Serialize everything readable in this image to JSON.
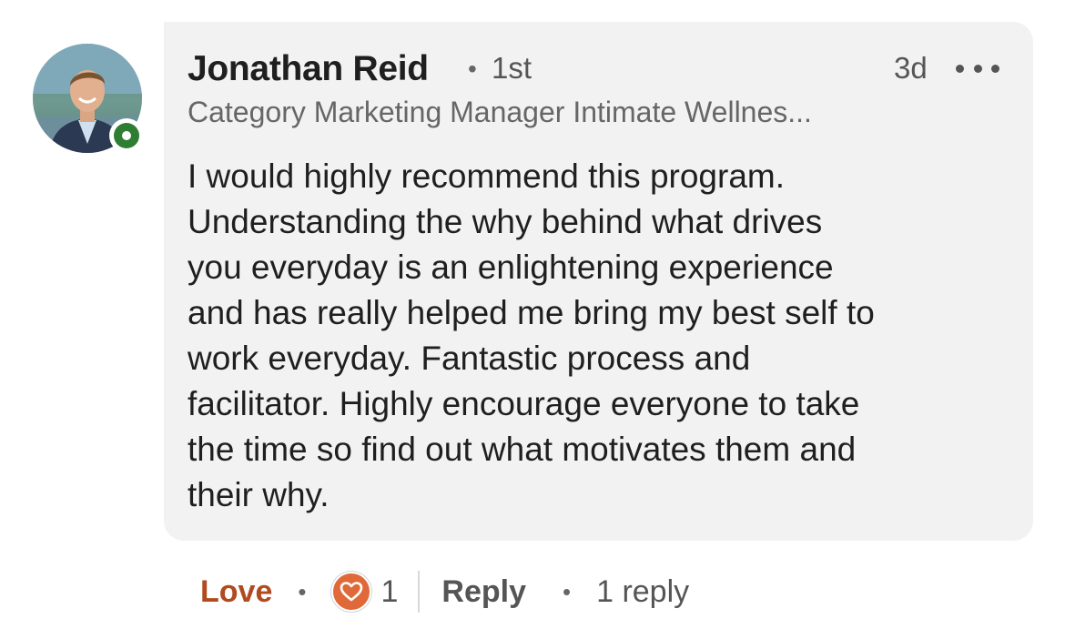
{
  "comment": {
    "author": {
      "name": "Jonathan Reid",
      "connection_degree": "1st",
      "headline": "Category Marketing Manager Intimate Wellnes...",
      "online_status": "online"
    },
    "time_ago": "3d",
    "separator": "•",
    "text": "I would highly recommend this program.\nUnderstanding the why behind what drives\nyou everyday is an enlightening experience\nand has really helped me bring my best self to\nwork everyday. Fantastic process and\nfacilitator. Highly encourage everyone to take\nthe time so find out what motivates them and\ntheir why.",
    "more_icon": "ellipsis-icon"
  },
  "actions": {
    "reaction_label": "Love",
    "separator": "•",
    "reaction_icon": "heart-icon",
    "reaction_count": "1",
    "reply_label": "Reply",
    "replies_text": "1 reply"
  },
  "colors": {
    "bubble_bg": "#f2f2f2",
    "love_accent": "#b14a1f",
    "heart_badge": "#e0693a",
    "online_green": "#2e7d32"
  }
}
